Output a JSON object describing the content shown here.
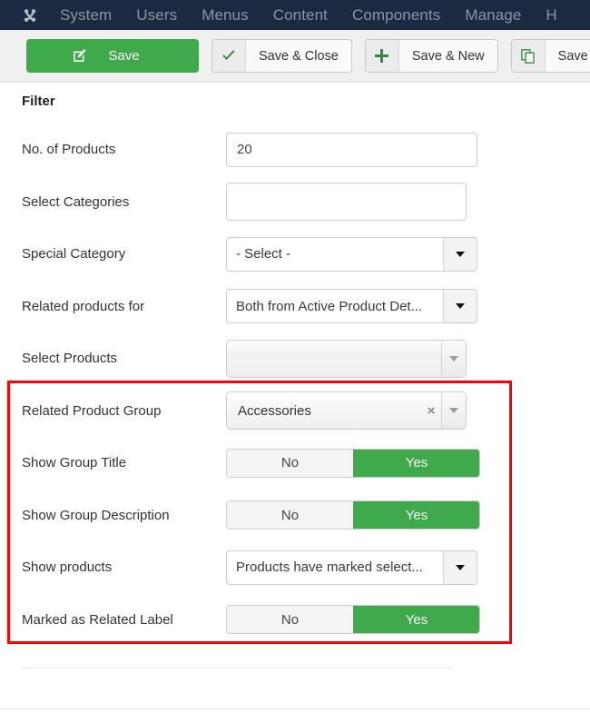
{
  "nav": {
    "logo_icon": "joomla-logo-icon",
    "items": [
      {
        "label": "System"
      },
      {
        "label": "Users"
      },
      {
        "label": "Menus"
      },
      {
        "label": "Content"
      },
      {
        "label": "Components"
      },
      {
        "label": "Manage"
      },
      {
        "label": "H"
      }
    ]
  },
  "toolbar": {
    "save": {
      "label": "Save",
      "icon": "edit-pencil-icon"
    },
    "save_close": {
      "label": "Save & Close",
      "icon": "check-icon"
    },
    "save_new": {
      "label": "Save & New",
      "icon": "plus-icon"
    },
    "save_as": {
      "label": "Save as",
      "icon": "copy-icon"
    }
  },
  "form": {
    "section_title": "Filter",
    "rows": {
      "no_of_products": {
        "label": "No. of Products",
        "value": "20",
        "placeholder": ""
      },
      "select_categories": {
        "label": "Select Categories",
        "value": "",
        "placeholder": ""
      },
      "special_category": {
        "label": "Special Category",
        "value": "- Select -"
      },
      "related_products_for": {
        "label": "Related products for",
        "value": "Both from Active Product Det..."
      },
      "select_products": {
        "label": "Select Products",
        "value": ""
      },
      "related_product_group": {
        "label": "Related Product Group",
        "value": "Accessories",
        "clear_icon": "×"
      },
      "show_group_title": {
        "label": "Show Group Title",
        "off_label": "No",
        "on_label": "Yes",
        "selected": "Yes"
      },
      "show_group_description": {
        "label": "Show Group Description",
        "off_label": "No",
        "on_label": "Yes",
        "selected": "Yes"
      },
      "show_products": {
        "label": "Show products",
        "value": "Products have marked select..."
      },
      "marked_as_related_label": {
        "label": "Marked as Related Label",
        "off_label": "No",
        "on_label": "Yes",
        "selected": "Yes"
      }
    }
  },
  "colors": {
    "nav_background": "#1c2a41",
    "accent_green": "#3faa4b",
    "highlight_red": "#ff0000",
    "toolbar_background": "#f0f0f0"
  }
}
